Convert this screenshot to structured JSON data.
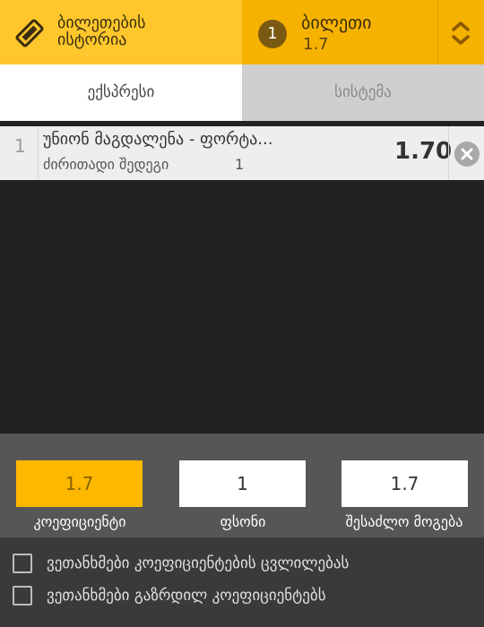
{
  "header": {
    "history_label_line1": "ბილეთების",
    "history_label_line2": "ისტორია",
    "ticket_count": "1",
    "betslip_title": "ბილეთი",
    "betslip_odds": "1.7"
  },
  "tabs": {
    "express": "ექსპრესი",
    "system": "სისტემა"
  },
  "bets": [
    {
      "index": "1",
      "event": "უნიონ მაგდალენა - ფორტა...",
      "market": "ძირითადი შედეგი",
      "selection": "1",
      "odds": "1.70"
    }
  ],
  "summary": {
    "coefficient_value": "1.7",
    "stake_value": "1",
    "possible_win_value": "1.7",
    "coefficient_label": "კოეფიციენტი",
    "stake_label": "ფსონი",
    "possible_win_label": "შესაძლო მოგება"
  },
  "agreements": {
    "accept_changes": "ვეთანხმები კოეფიციენტების ცვლილებას",
    "accept_increased": "ვეთანხმები გაზრდილ კოეფიციენტებს"
  },
  "colors": {
    "accent": "#ffc72c",
    "accent_dark": "#f6b200",
    "coefficient_field": "#ffb800"
  },
  "icons": {
    "history": "ticket-icon",
    "toggle": "chevron-up-down-icon",
    "remove": "close-circle-icon"
  }
}
